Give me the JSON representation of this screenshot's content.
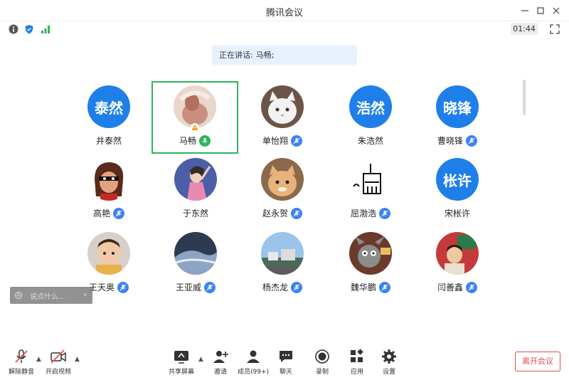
{
  "window": {
    "title": "腾讯会议"
  },
  "status": {
    "timer": "01:44"
  },
  "banner": {
    "label": "正在讲话:",
    "name": "马畅;"
  },
  "participants": [
    {
      "name": "井泰然",
      "avatar_text": "泰然",
      "mic": "none"
    },
    {
      "name": "马畅",
      "avatar_text": "",
      "mic": "speaking"
    },
    {
      "name": "单怡翔",
      "avatar_text": "",
      "mic": "muted"
    },
    {
      "name": "朱浩然",
      "avatar_text": "浩然",
      "mic": "none"
    },
    {
      "name": "曹晓锋",
      "avatar_text": "晓锋",
      "mic": "muted"
    },
    {
      "name": "高艳",
      "avatar_text": "",
      "mic": "muted"
    },
    {
      "name": "于东然",
      "avatar_text": "",
      "mic": "none"
    },
    {
      "name": "赵永贺",
      "avatar_text": "",
      "mic": "muted"
    },
    {
      "name": "屈渤浩",
      "avatar_text": "",
      "mic": "muted"
    },
    {
      "name": "宋枨许",
      "avatar_text": "枨许",
      "mic": "none"
    },
    {
      "name": "王天奥",
      "avatar_text": "",
      "mic": "muted"
    },
    {
      "name": "王亚威",
      "avatar_text": "",
      "mic": "muted"
    },
    {
      "name": "杨杰龙",
      "avatar_text": "",
      "mic": "muted"
    },
    {
      "name": "魏华鹏",
      "avatar_text": "",
      "mic": "muted"
    },
    {
      "name": "闫善鑫",
      "avatar_text": "",
      "mic": "muted"
    }
  ],
  "chat": {
    "placeholder": "说点什么...",
    "arrow": "‹"
  },
  "toolbar": {
    "unmute": "解除静音",
    "start_video": "开启视频",
    "share_screen": "共享屏幕",
    "invite": "邀请",
    "members": "成员(99+)",
    "chat": "聊天",
    "record": "录制",
    "apps": "应用",
    "settings": "设置",
    "leave": "离开会议"
  },
  "colors": {
    "accent": "#1f7fe8",
    "speaking": "#2db55d",
    "leave": "#e24d4d"
  }
}
